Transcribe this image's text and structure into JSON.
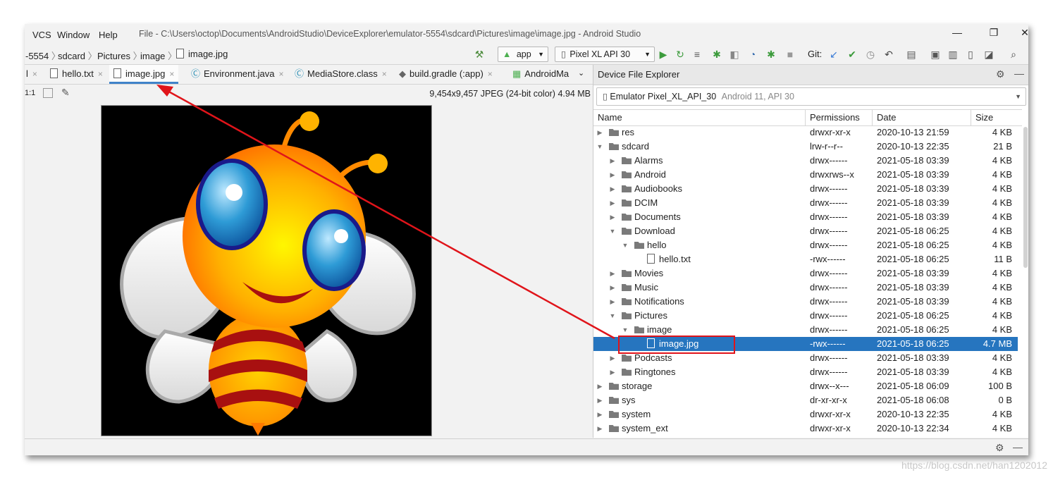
{
  "menu": {
    "items": [
      "VCS",
      "Window",
      "Help"
    ],
    "title": "File - C:\\Users\\octop\\Documents\\AndroidStudio\\DeviceExplorer\\emulator-5554\\sdcard\\Pictures\\image\\image.jpg - Android Studio",
    "minimize": "—",
    "restore": "❐",
    "close": "✕"
  },
  "breadcrumb": [
    "-5554",
    "sdcard",
    "Pictures",
    "image",
    "image.jpg"
  ],
  "toolbar": {
    "app_config": "app",
    "device": "Pixel XL API 30",
    "git_label": "Git:"
  },
  "tabs": [
    {
      "label": "l",
      "active": false
    },
    {
      "label": "hello.txt",
      "active": false
    },
    {
      "label": "image.jpg",
      "active": true
    },
    {
      "label": "Environment.java",
      "active": false
    },
    {
      "label": "MediaStore.class",
      "active": false
    },
    {
      "label": "build.gradle (:app)",
      "active": false
    },
    {
      "label": "AndroidMa",
      "active": false
    }
  ],
  "image_editor": {
    "zoom": "1:1",
    "info": "9,454x9,457 JPEG (24-bit color) 4.94 MB"
  },
  "device_explorer": {
    "title": "Device File Explorer",
    "device": "Emulator Pixel_XL_API_30",
    "device_detail": "Android 11, API 30",
    "columns": [
      "Name",
      "Permissions",
      "Date",
      "Size"
    ],
    "rows": [
      {
        "name": "res",
        "perm": "drwxr-xr-x",
        "date": "2020-10-13 21:59",
        "size": "4 KB",
        "depth": 0,
        "type": "folder",
        "expanded": false
      },
      {
        "name": "sdcard",
        "perm": "lrw-r--r--",
        "date": "2020-10-13 22:35",
        "size": "21 B",
        "depth": 0,
        "type": "link",
        "expanded": true
      },
      {
        "name": "Alarms",
        "perm": "drwx------",
        "date": "2021-05-18 03:39",
        "size": "4 KB",
        "depth": 1,
        "type": "folder",
        "expanded": false
      },
      {
        "name": "Android",
        "perm": "drwxrws--x",
        "date": "2021-05-18 03:39",
        "size": "4 KB",
        "depth": 1,
        "type": "folder",
        "expanded": false
      },
      {
        "name": "Audiobooks",
        "perm": "drwx------",
        "date": "2021-05-18 03:39",
        "size": "4 KB",
        "depth": 1,
        "type": "folder",
        "expanded": false
      },
      {
        "name": "DCIM",
        "perm": "drwx------",
        "date": "2021-05-18 03:39",
        "size": "4 KB",
        "depth": 1,
        "type": "folder",
        "expanded": false
      },
      {
        "name": "Documents",
        "perm": "drwx------",
        "date": "2021-05-18 03:39",
        "size": "4 KB",
        "depth": 1,
        "type": "folder",
        "expanded": false
      },
      {
        "name": "Download",
        "perm": "drwx------",
        "date": "2021-05-18 06:25",
        "size": "4 KB",
        "depth": 1,
        "type": "folder",
        "expanded": true
      },
      {
        "name": "hello",
        "perm": "drwx------",
        "date": "2021-05-18 06:25",
        "size": "4 KB",
        "depth": 2,
        "type": "folder",
        "expanded": true
      },
      {
        "name": "hello.txt",
        "perm": "-rwx------",
        "date": "2021-05-18 06:25",
        "size": "11 B",
        "depth": 3,
        "type": "file"
      },
      {
        "name": "Movies",
        "perm": "drwx------",
        "date": "2021-05-18 03:39",
        "size": "4 KB",
        "depth": 1,
        "type": "folder",
        "expanded": false
      },
      {
        "name": "Music",
        "perm": "drwx------",
        "date": "2021-05-18 03:39",
        "size": "4 KB",
        "depth": 1,
        "type": "folder",
        "expanded": false
      },
      {
        "name": "Notifications",
        "perm": "drwx------",
        "date": "2021-05-18 03:39",
        "size": "4 KB",
        "depth": 1,
        "type": "folder",
        "expanded": false
      },
      {
        "name": "Pictures",
        "perm": "drwx------",
        "date": "2021-05-18 06:25",
        "size": "4 KB",
        "depth": 1,
        "type": "folder",
        "expanded": true
      },
      {
        "name": "image",
        "perm": "drwx------",
        "date": "2021-05-18 06:25",
        "size": "4 KB",
        "depth": 2,
        "type": "folder",
        "expanded": true
      },
      {
        "name": "image.jpg",
        "perm": "-rwx------",
        "date": "2021-05-18 06:25",
        "size": "4.7 MB",
        "depth": 3,
        "type": "file",
        "selected": true
      },
      {
        "name": "Podcasts",
        "perm": "drwx------",
        "date": "2021-05-18 03:39",
        "size": "4 KB",
        "depth": 1,
        "type": "folder",
        "expanded": false
      },
      {
        "name": "Ringtones",
        "perm": "drwx------",
        "date": "2021-05-18 03:39",
        "size": "4 KB",
        "depth": 1,
        "type": "folder",
        "expanded": false
      },
      {
        "name": "storage",
        "perm": "drwx--x---",
        "date": "2021-05-18 06:09",
        "size": "100 B",
        "depth": 0,
        "type": "folder",
        "expanded": false
      },
      {
        "name": "sys",
        "perm": "dr-xr-xr-x",
        "date": "2021-05-18 06:08",
        "size": "0 B",
        "depth": 0,
        "type": "folder",
        "expanded": false
      },
      {
        "name": "system",
        "perm": "drwxr-xr-x",
        "date": "2020-10-13 22:35",
        "size": "4 KB",
        "depth": 0,
        "type": "folder",
        "expanded": false
      },
      {
        "name": "system_ext",
        "perm": "drwxr-xr-x",
        "date": "2020-10-13 22:34",
        "size": "4 KB",
        "depth": 0,
        "type": "folder",
        "expanded": false
      }
    ]
  },
  "colors": {
    "selection": "#2675bf",
    "annotation": "#e0141a",
    "tab_underline": "#4083c9"
  },
  "watermark": "https://blog.csdn.net/han1202012"
}
